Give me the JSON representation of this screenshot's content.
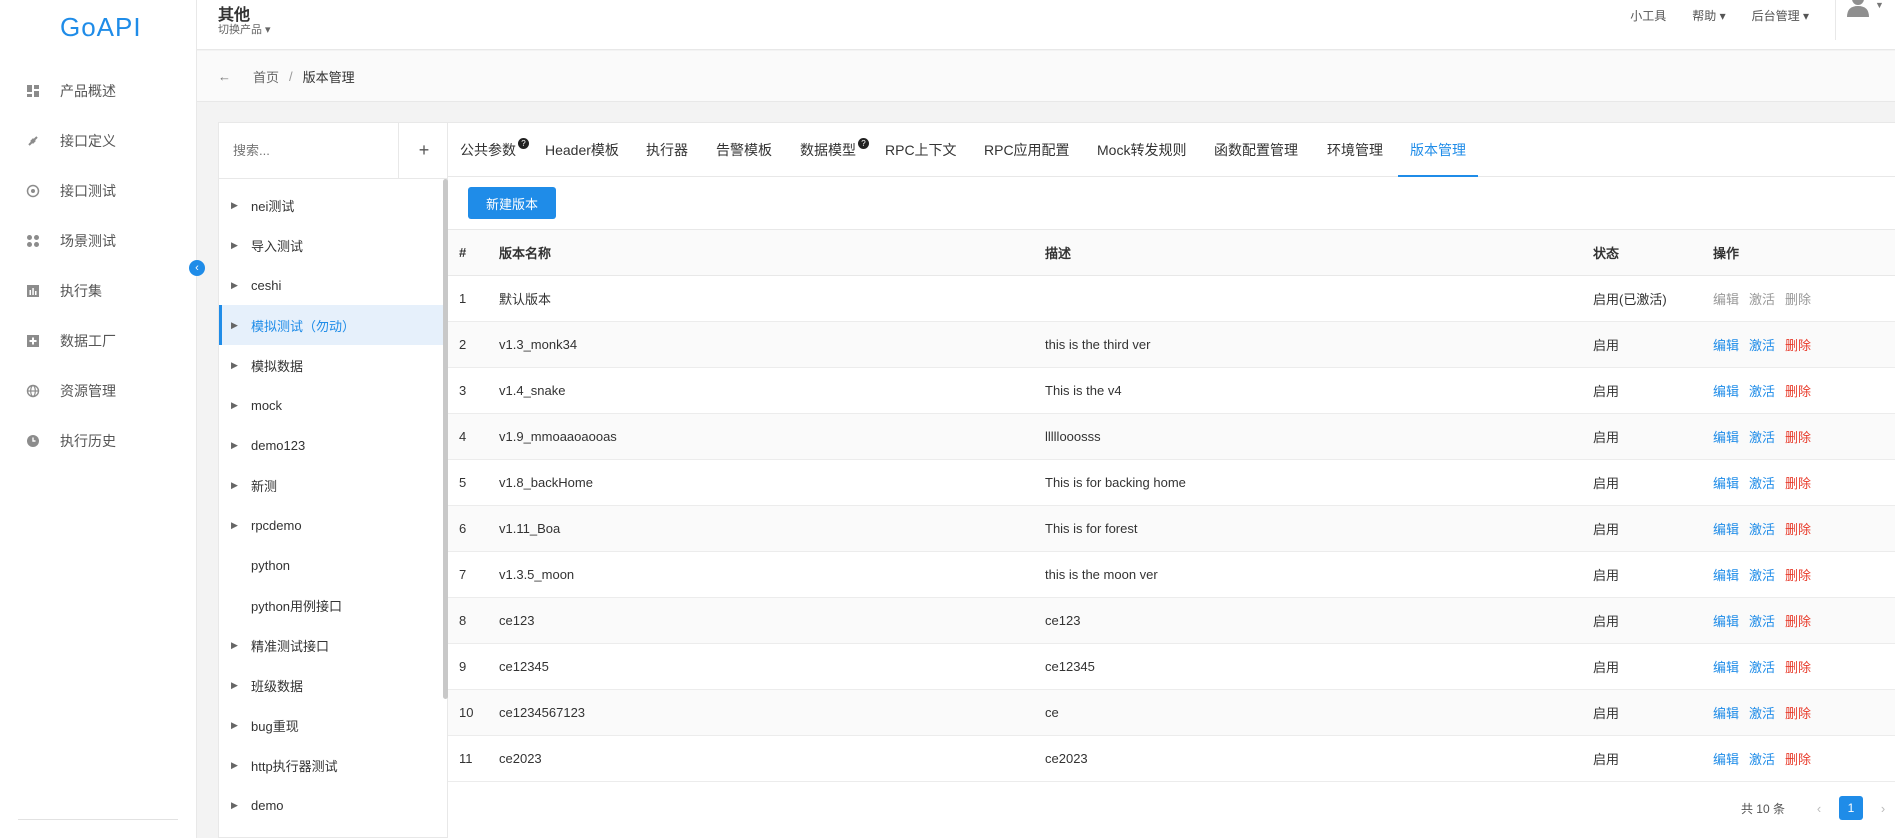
{
  "logo": {
    "text": "GoAPI"
  },
  "nav": {
    "items": [
      {
        "label": "产品概述",
        "icon": "dashboard-icon"
      },
      {
        "label": "接口定义",
        "icon": "plug-icon"
      },
      {
        "label": "接口测试",
        "icon": "target-icon"
      },
      {
        "label": "场景测试",
        "icon": "scenario-icon"
      },
      {
        "label": "执行集",
        "icon": "chart-icon"
      },
      {
        "label": "数据工厂",
        "icon": "factory-icon"
      },
      {
        "label": "资源管理",
        "icon": "globe-icon"
      },
      {
        "label": "执行历史",
        "icon": "clock-icon"
      }
    ],
    "collapse_icon": "‹"
  },
  "header": {
    "product_title": "其他",
    "product_switch": "切换产品 ▾",
    "links": [
      "小工具",
      "帮助 ▾",
      "后台管理 ▾"
    ]
  },
  "breadcrumb": {
    "back": "←",
    "home": "首页",
    "sep": "/",
    "current": "版本管理"
  },
  "tree": {
    "search_placeholder": "搜索...",
    "add_label": "+",
    "items": [
      {
        "label": "nei测试",
        "caret": "▶"
      },
      {
        "label": "导入测试",
        "caret": "▶"
      },
      {
        "label": "ceshi",
        "caret": "▶"
      },
      {
        "label": "模拟测试（勿动）",
        "caret": "▶"
      },
      {
        "label": "模拟数据",
        "caret": "▶"
      },
      {
        "label": "mock",
        "caret": "▶"
      },
      {
        "label": "demo123",
        "caret": "▶"
      },
      {
        "label": "新测",
        "caret": "▶"
      },
      {
        "label": "rpcdemo",
        "caret": "▶"
      },
      {
        "label": "python",
        "caret": ""
      },
      {
        "label": "python用例接口",
        "caret": ""
      },
      {
        "label": "精准测试接口",
        "caret": "▶"
      },
      {
        "label": "班级数据",
        "caret": "▶"
      },
      {
        "label": "bug重现",
        "caret": "▶"
      },
      {
        "label": "http执行器测试",
        "caret": "▶"
      },
      {
        "label": "demo",
        "caret": "▶"
      }
    ]
  },
  "tabs": [
    {
      "label": "公共参数",
      "help": "?"
    },
    {
      "label": "Header模板",
      "help": ""
    },
    {
      "label": "执行器",
      "help": ""
    },
    {
      "label": "告警模板",
      "help": ""
    },
    {
      "label": "数据模型",
      "help": "?"
    },
    {
      "label": "RPC上下文",
      "help": ""
    },
    {
      "label": "RPC应用配置",
      "help": ""
    },
    {
      "label": "Mock转发规则",
      "help": ""
    },
    {
      "label": "函数配置管理",
      "help": ""
    },
    {
      "label": "环境管理",
      "help": ""
    },
    {
      "label": "版本管理",
      "help": ""
    }
  ],
  "new_button": "新建版本",
  "table": {
    "headers": [
      "#",
      "版本名称",
      "描述",
      "状态",
      "操作"
    ],
    "actions": {
      "edit": "编辑",
      "activate": "激活",
      "delete": "删除"
    },
    "rows": [
      {
        "idx": "1",
        "name": "默认版本",
        "desc": "",
        "status": "启用(已激活)"
      },
      {
        "idx": "2",
        "name": "v1.3_monk34",
        "desc": "this is the third ver",
        "status": "启用"
      },
      {
        "idx": "3",
        "name": "v1.4_snake",
        "desc": "This is the v4",
        "status": "启用"
      },
      {
        "idx": "4",
        "name": "v1.9_mmoaaoaooas",
        "desc": "lllllooosss",
        "status": "启用"
      },
      {
        "idx": "5",
        "name": "v1.8_backHome",
        "desc": "This is for backing home",
        "status": "启用"
      },
      {
        "idx": "6",
        "name": "v1.11_Boa",
        "desc": "This is for forest",
        "status": "启用"
      },
      {
        "idx": "7",
        "name": "v1.3.5_moon",
        "desc": "this is the moon ver",
        "status": "启用"
      },
      {
        "idx": "8",
        "name": "ce123",
        "desc": "ce123",
        "status": "启用"
      },
      {
        "idx": "9",
        "name": "ce12345",
        "desc": "ce12345",
        "status": "启用"
      },
      {
        "idx": "10",
        "name": "ce1234567123",
        "desc": "ce",
        "status": "启用"
      },
      {
        "idx": "11",
        "name": "ce2023",
        "desc": "ce2023",
        "status": "启用"
      }
    ]
  },
  "pager": {
    "total": "共 10 条",
    "prev": "‹",
    "page": "1",
    "next": "›"
  },
  "colors": {
    "accent": "#1f8ce8",
    "success": "#23b35a",
    "danger": "#e83a2a"
  }
}
